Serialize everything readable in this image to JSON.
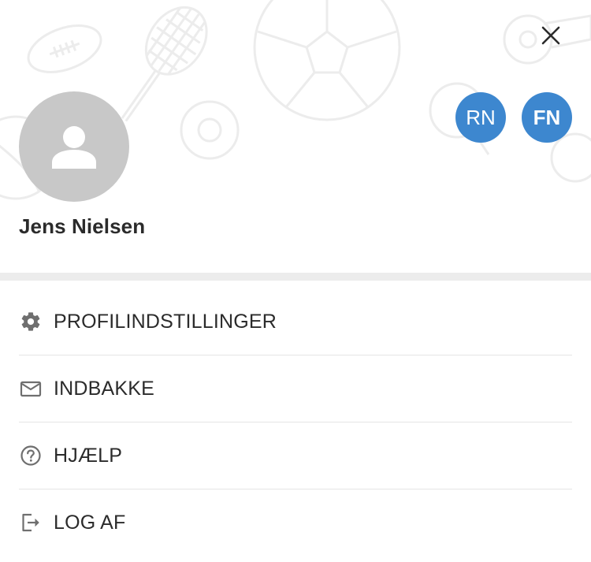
{
  "header": {
    "user_name": "Jens Nielsen",
    "profiles": [
      {
        "initials": "RN"
      },
      {
        "initials": "FN"
      }
    ]
  },
  "menu": {
    "items": [
      {
        "label": "PROFILINDSTILLINGER",
        "icon": "gear-icon"
      },
      {
        "label": "INDBAKKE",
        "icon": "envelope-icon"
      },
      {
        "label": "HJÆLP",
        "icon": "help-circle-icon"
      },
      {
        "label": "LOG AF",
        "icon": "logout-icon"
      }
    ]
  },
  "colors": {
    "accent": "#3d87cf",
    "avatar_bg": "#c8c8c8",
    "text": "#2b2b2b",
    "divider": "#ececec"
  }
}
